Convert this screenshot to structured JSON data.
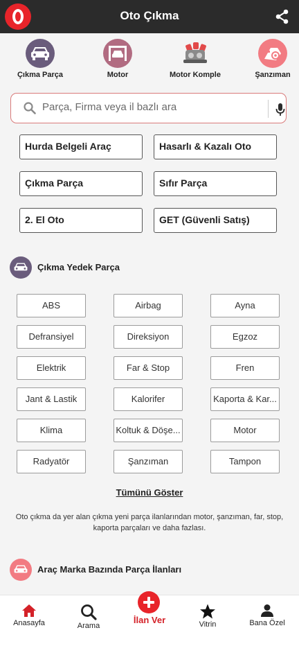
{
  "header": {
    "title": "Oto Çıkma"
  },
  "categories": [
    {
      "label": "Çıkma Parça",
      "icon": "car-front-icon",
      "color": "#6a5c7c"
    },
    {
      "label": "Motor",
      "icon": "car-lift-icon",
      "color": "#b16b81"
    },
    {
      "label": "Motor Komple",
      "icon": "engine-icon",
      "color": "#f4f4f4"
    },
    {
      "label": "Şanzıman",
      "icon": "gearbox-icon",
      "color": "#f27b82"
    }
  ],
  "search": {
    "placeholder": "Parça, Firma veya il bazlı ara"
  },
  "quick_links": [
    "Hurda Belgeli Araç",
    "Hasarlı & Kazalı Oto",
    "Çıkma Parça",
    "Sıfır Parça",
    "2. El Oto",
    "GET (Güvenli Satış)"
  ],
  "parts_section": {
    "title": "Çıkma Yedek Parça"
  },
  "parts": [
    "ABS",
    "Airbag",
    "Ayna",
    "Defransiyel",
    "Direksiyon",
    "Egzoz",
    "Elektrik",
    "Far & Stop",
    "Fren",
    "Jant & Lastik",
    "Kalorifer",
    "Kaporta & Kar...",
    "Klima",
    "Koltuk & Döşe...",
    "Motor",
    "Radyatör",
    "Şanzıman",
    "Tampon"
  ],
  "show_all": "Tümünü Göster",
  "description": "Oto çıkma da yer alan çıkma yeni parça ilanlarından motor, şanzıman, far, stop, kaporta parçaları ve daha fazlası.",
  "brand_section": {
    "title": "Araç Marka Bazında Parça İlanları"
  },
  "bottom_nav": {
    "home": "Anasayfa",
    "search": "Arama",
    "post": "İlan Ver",
    "showcase": "Vitrin",
    "profile": "Bana Özel"
  },
  "colors": {
    "brand_red": "#e8242a",
    "header_bg": "#2b2b2b",
    "accent_purple": "#6a5c7c",
    "accent_pink": "#f27b82"
  }
}
